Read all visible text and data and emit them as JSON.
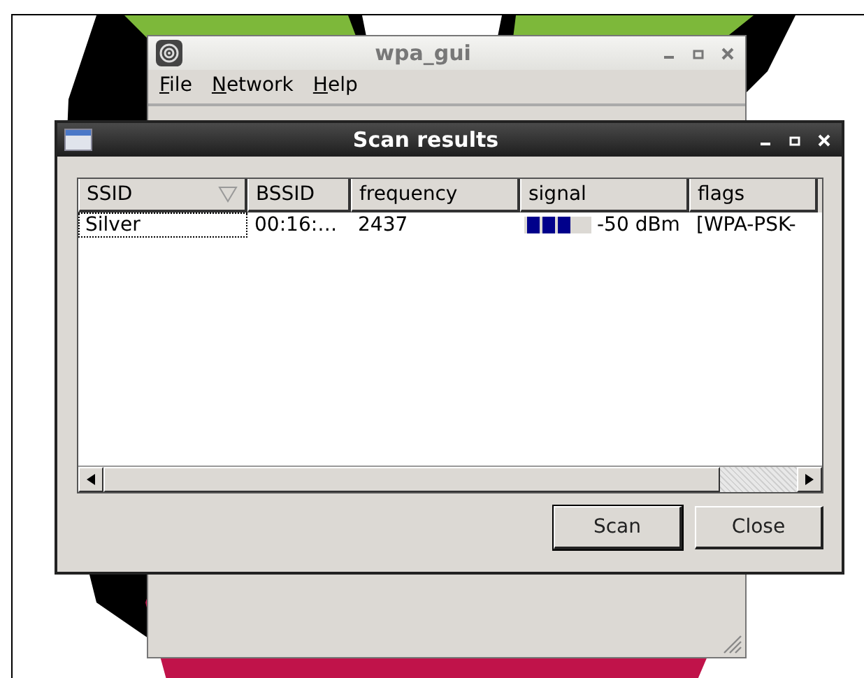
{
  "main_window": {
    "title": "wpa_gui",
    "menu": [
      {
        "label": "File"
      },
      {
        "label": "Network"
      },
      {
        "label": "Help"
      }
    ]
  },
  "scan_dialog": {
    "title": "Scan results",
    "columns": [
      {
        "label": "SSID",
        "sorted": true
      },
      {
        "label": "BSSID",
        "sorted": false
      },
      {
        "label": "frequency",
        "sorted": false
      },
      {
        "label": "signal",
        "sorted": false
      },
      {
        "label": "flags",
        "sorted": false
      }
    ],
    "rows": [
      {
        "focused": true,
        "ssid": "Silver",
        "bssid": "00:16:…",
        "frequency": "2437",
        "signal": {
          "level": 0.75,
          "reading": "-50 dBm"
        },
        "flags": "[WPA-PSK-"
      }
    ],
    "buttons": [
      {
        "label": "Scan",
        "default": true
      },
      {
        "label": "Close",
        "default": false
      }
    ]
  }
}
